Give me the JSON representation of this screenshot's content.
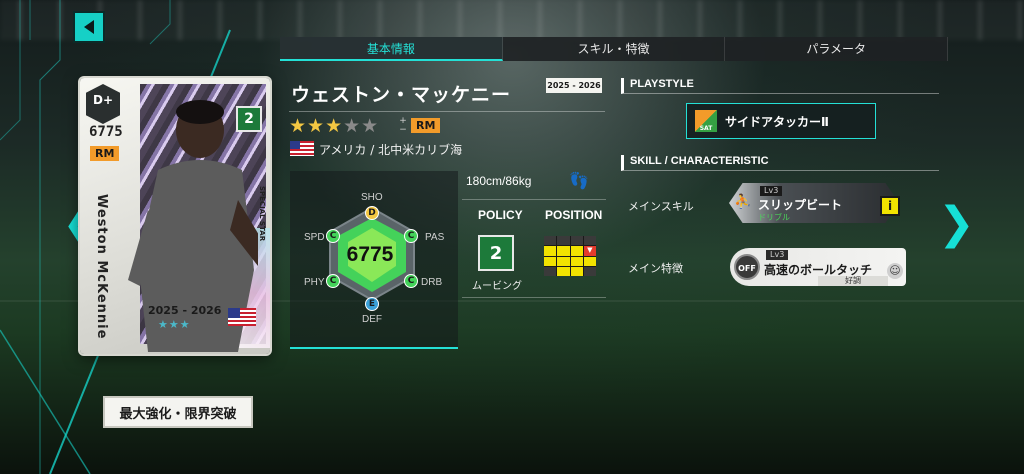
{
  "tabs": [
    {
      "label": "基本情報",
      "active": true
    },
    {
      "label": "スキル・特徴",
      "active": false
    },
    {
      "label": "パラメータ",
      "active": false
    }
  ],
  "card": {
    "rank": "D+",
    "ovr": "6775",
    "position": "RM",
    "name": "Weston McKennie",
    "special": "SPECIAL STAR",
    "season": "2025 - 2026",
    "stars": "★★★",
    "policy_glyph": "2"
  },
  "enhance_button": "最大強化・限界突破",
  "player": {
    "name": "ウェストン・マッケニー",
    "season_badge": "2025 - 2026",
    "rarity": {
      "filled": "★★★",
      "empty": "★★",
      "count": 3,
      "max": 5
    },
    "position": "RM",
    "nation": "アメリカ / 北中米カリブ海",
    "body": "180cm/86kg"
  },
  "stats": {
    "ovr": "6775",
    "labels": {
      "sho": "SHO",
      "pas": "PAS",
      "drb": "DRB",
      "def": "DEF",
      "phy": "PHY",
      "spd": "SPD"
    },
    "grades": {
      "sho": "D",
      "pas": "C",
      "drb": "C",
      "def": "E",
      "phy": "C",
      "spd": "C"
    }
  },
  "policy": {
    "head": "POLICY",
    "label": "ムービング",
    "glyph": "2"
  },
  "position_head": "POSITION",
  "right": {
    "playstyle_head": "PLAYSTYLE",
    "playstyle": "サイドアタッカーⅡ",
    "playstyle_icon_tag": "SAT",
    "skill_head": "SKILL / CHARACTERISTIC",
    "main_skill_label": "メインスキル",
    "main_skill": {
      "lv": "Lv3",
      "name": "スリップビート",
      "sub": "ドリブル",
      "type": "i"
    },
    "main_trait_label": "メイン特徴",
    "main_trait": {
      "lv": "Lv3",
      "name": "高速のボールタッチ",
      "state": "好調",
      "off": "OFF"
    }
  },
  "icons": {
    "back": "back-arrow-icon",
    "prev": "chevron-left-icon",
    "next": "chevron-right-icon",
    "footprint": "footprint-icon",
    "flag": "us-flag-icon"
  },
  "colors": {
    "accent": "#24e0d6",
    "position": "#f29b2a",
    "star": "#f3c742"
  }
}
